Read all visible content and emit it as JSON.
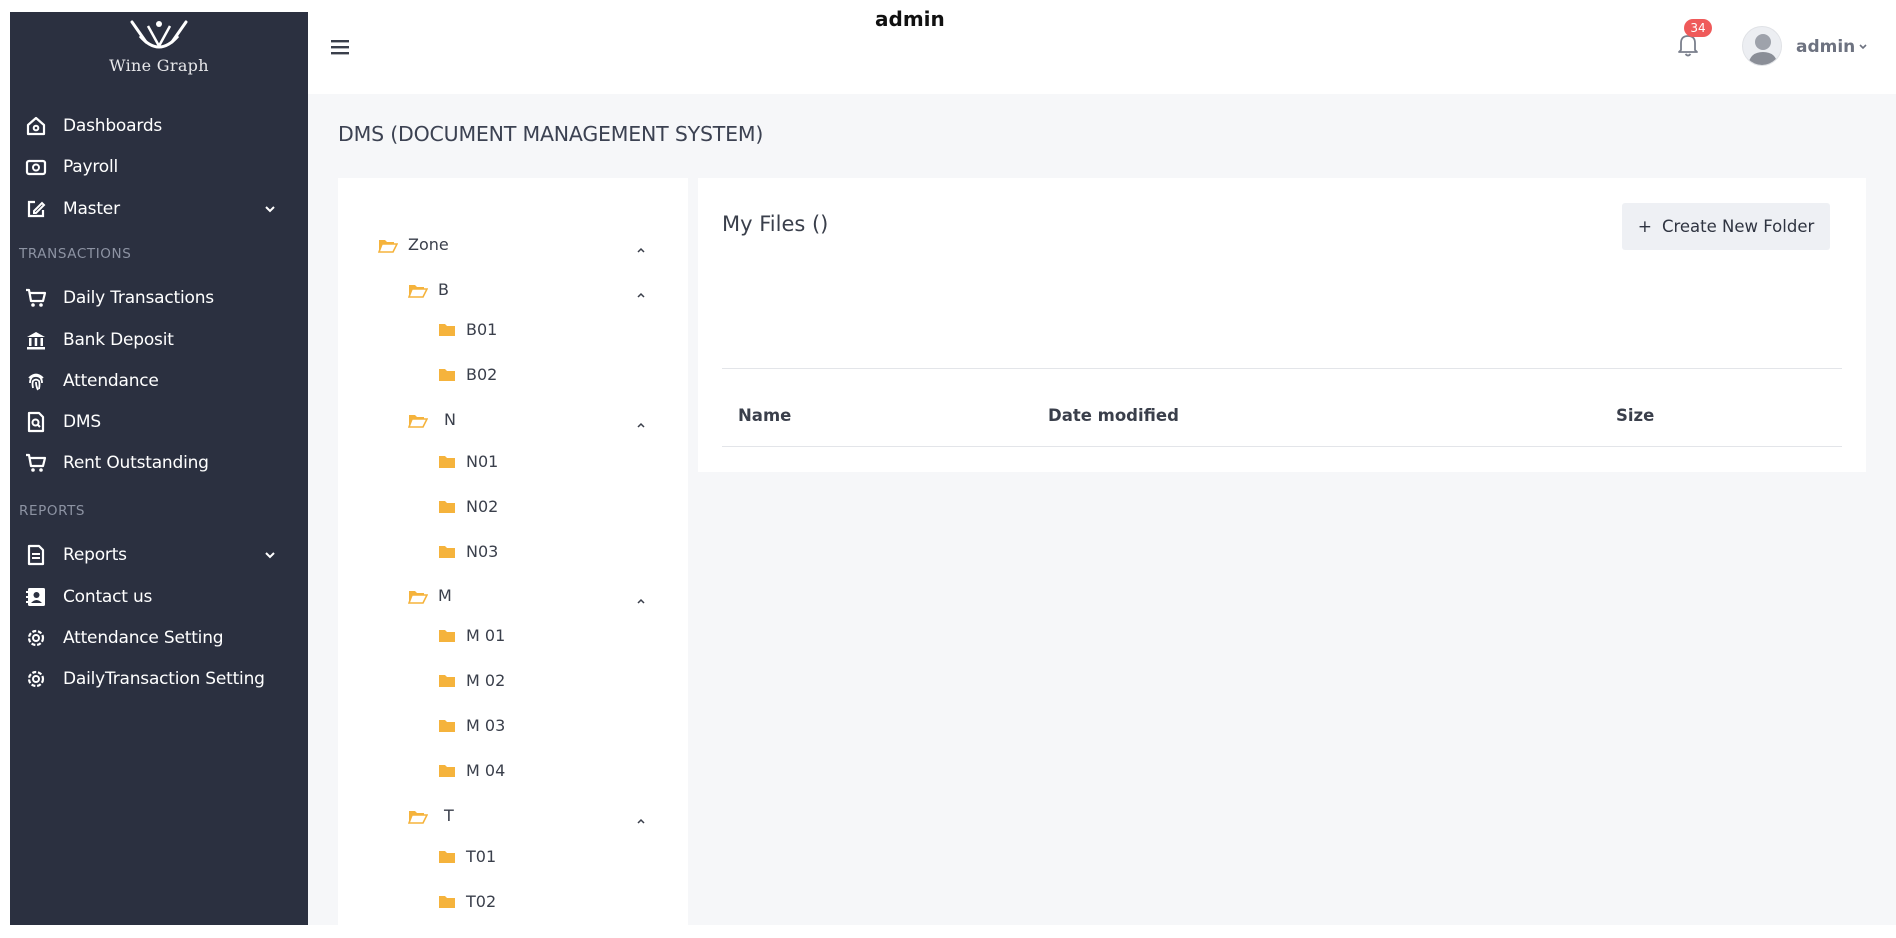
{
  "app": {
    "logo_text": "Wine Graph",
    "top_title": "admin"
  },
  "sidebar": {
    "items": [
      {
        "label": "Dashboards",
        "icon": "home-icon"
      },
      {
        "label": "Payroll",
        "icon": "money-icon"
      },
      {
        "label": "Master",
        "icon": "edit-icon",
        "expandable": true
      },
      {
        "label": "Daily Transactions",
        "icon": "cart-icon"
      },
      {
        "label": "Bank Deposit",
        "icon": "bank-icon"
      },
      {
        "label": "Attendance",
        "icon": "fingerprint-icon"
      },
      {
        "label": "DMS",
        "icon": "document-search-icon"
      },
      {
        "label": "Rent Outstanding",
        "icon": "cart-icon"
      },
      {
        "label": "Reports",
        "icon": "file-icon",
        "expandable": true
      },
      {
        "label": "Contact us",
        "icon": "contact-icon"
      },
      {
        "label": "Attendance Setting",
        "icon": "gear-icon"
      },
      {
        "label": "DailyTransaction Setting",
        "icon": "gear-icon"
      }
    ],
    "sections": {
      "transactions": "TRANSACTIONS",
      "reports": "REPORTS"
    }
  },
  "header": {
    "notification_count": "34",
    "user_name": "admin"
  },
  "page": {
    "title": "DMS (DOCUMENT MANAGEMENT SYSTEM)"
  },
  "tree": {
    "root": "Zone",
    "groups": [
      {
        "label": "B",
        "children": [
          "B01",
          "B02"
        ]
      },
      {
        "label": "N",
        "children": [
          "N01",
          "N02",
          "N03"
        ]
      },
      {
        "label": "M",
        "children": [
          "M 01",
          "M 02",
          "M 03",
          "M 04"
        ]
      },
      {
        "label": "T",
        "children": [
          "T01",
          "T02"
        ]
      }
    ]
  },
  "files": {
    "title": "My Files ()",
    "create_button": "Create New Folder",
    "columns": [
      "Name",
      "Date modified",
      "Size"
    ]
  },
  "colors": {
    "sidebar": "#2b3040",
    "folder": "#f5b33c",
    "badge": "#ef5a5a",
    "background": "#f6f7f9"
  }
}
